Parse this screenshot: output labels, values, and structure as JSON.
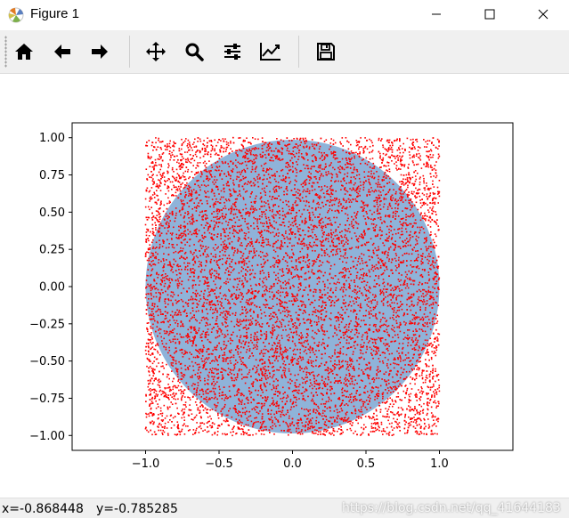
{
  "window": {
    "title": "Figure 1"
  },
  "toolbar": {
    "buttons": [
      {
        "name": "home",
        "icon": "home-icon"
      },
      {
        "name": "back",
        "icon": "arrow-left-icon"
      },
      {
        "name": "forward",
        "icon": "arrow-right-icon"
      },
      {
        "name": "pan",
        "icon": "move-icon"
      },
      {
        "name": "zoom",
        "icon": "magnifier-icon"
      },
      {
        "name": "subplots",
        "icon": "sliders-icon"
      },
      {
        "name": "edit-axis",
        "icon": "line-chart-icon"
      },
      {
        "name": "save",
        "icon": "floppy-disk-icon"
      }
    ]
  },
  "status": {
    "x_text": "x=-0.868448",
    "y_text": "y=-0.785285",
    "watermark": "https://blog.csdn.net/qq_41644183"
  },
  "colors": {
    "points": "#ff0000",
    "circle_fill": "#8fb3d9",
    "toolbar_bg": "#f0f0f0"
  },
  "chart_data": {
    "type": "scatter",
    "title": "",
    "xlabel": "",
    "ylabel": "",
    "xlim": [
      -1.5,
      1.5
    ],
    "ylim": [
      -1.1,
      1.1
    ],
    "xticks": [
      "−1.0",
      "−0.5",
      "0.0",
      "0.5",
      "1.0"
    ],
    "xtick_values": [
      -1.0,
      -0.5,
      0.0,
      0.5,
      1.0
    ],
    "yticks": [
      "1.00",
      "0.75",
      "0.50",
      "0.25",
      "0.00",
      "−0.25",
      "−0.50",
      "−0.75",
      "−1.00"
    ],
    "ytick_values": [
      1.0,
      0.75,
      0.5,
      0.25,
      0.0,
      -0.25,
      -0.5,
      -0.75,
      -1.0
    ],
    "circle": {
      "center": [
        0,
        0
      ],
      "radius": 1.0,
      "fill": "#8fb3d9"
    },
    "series": [
      {
        "marker": "point",
        "color": "#ff0000",
        "n_points": 10000,
        "x_range": [
          -1,
          1
        ],
        "y_range": [
          -1,
          1
        ],
        "distribution": "uniform"
      }
    ],
    "grid": false
  }
}
